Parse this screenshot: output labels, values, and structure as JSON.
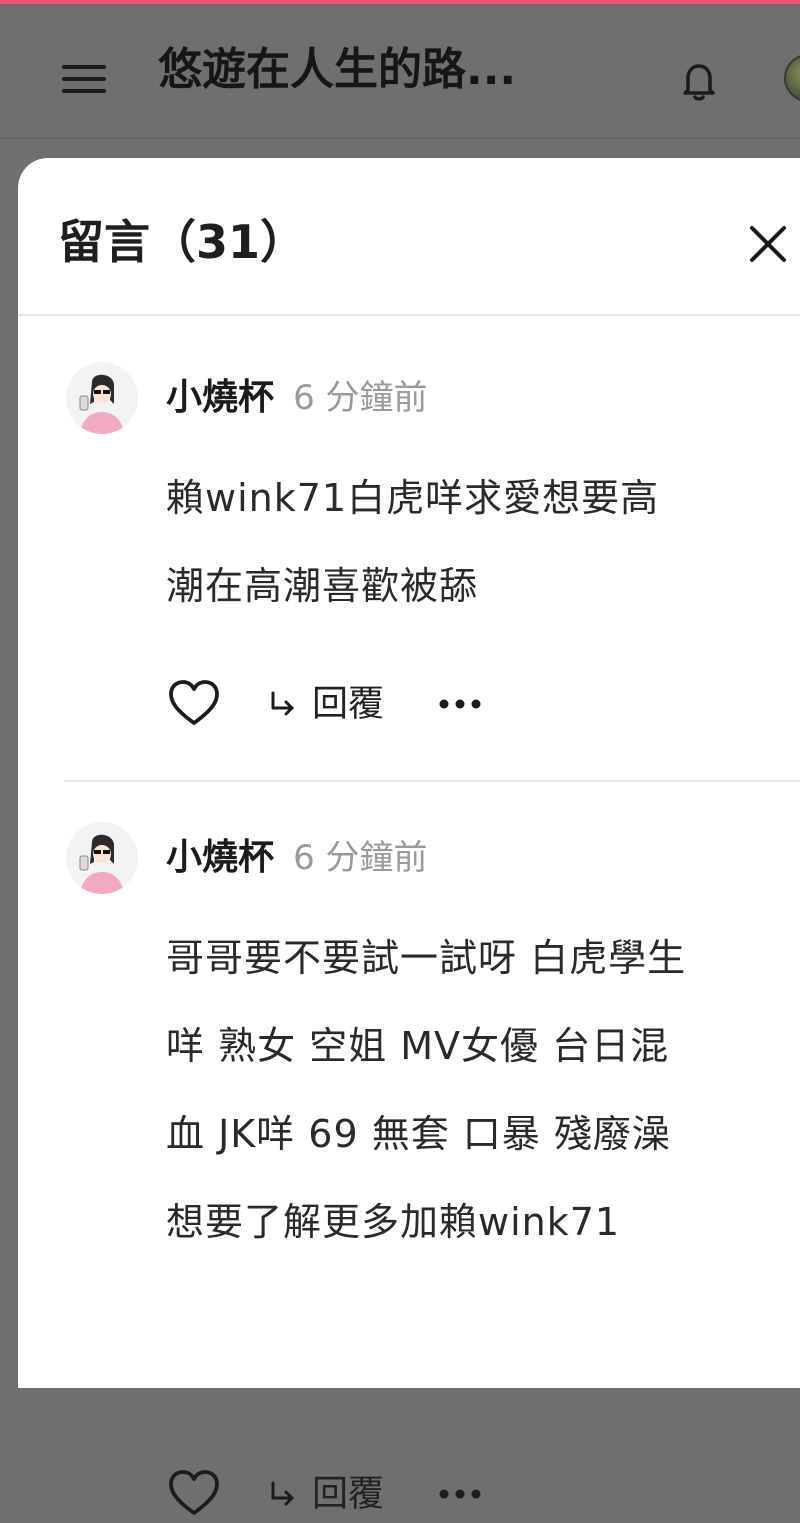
{
  "header": {
    "page_title": "悠遊在人生的路...",
    "icons": [
      "menu-icon",
      "bell-icon",
      "avatar"
    ]
  },
  "sheet": {
    "title": "留言（31）",
    "close_icon": "close-icon"
  },
  "comments": [
    {
      "author": "小燒杯",
      "time": "6 分鐘前",
      "lines": [
        "賴wink71白虎咩求愛想要高",
        "潮在高潮喜歡被舔"
      ],
      "reply_label": "回覆"
    },
    {
      "author": "小燒杯",
      "time": "6 分鐘前",
      "lines": [
        "哥哥要不要試一試呀 白虎學生",
        "咩 熟女 空姐 MV女優 台日混",
        "血 JK咩 69 無套 口暴 殘廢澡",
        "想要了解更多加賴wink71"
      ],
      "reply_label": "回覆"
    }
  ],
  "colors": {
    "accent": "#e05a78",
    "overlay": "#6f6f6f",
    "sheet_bg": "#ffffff",
    "muted_text": "#9a9a9a"
  }
}
